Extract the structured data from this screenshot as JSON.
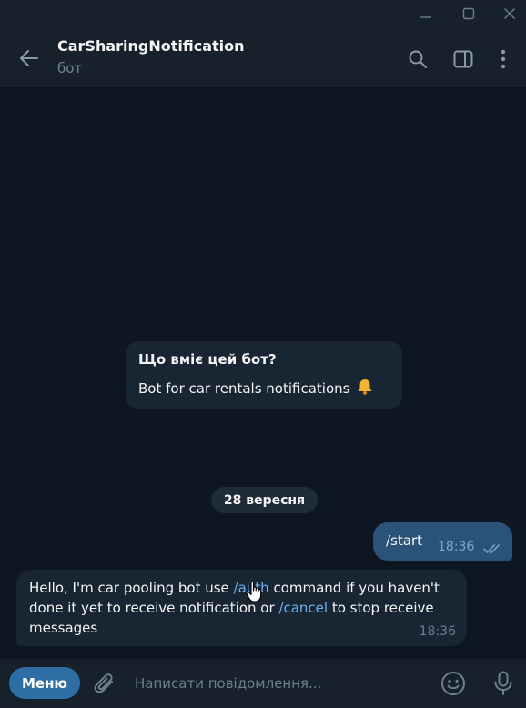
{
  "chat": {
    "title": "CarSharingNotification",
    "subtitle": "бот"
  },
  "intro": {
    "heading": "Що вміє цей бот?",
    "description": "Bot for car rentals notifications"
  },
  "date_separator": "28 вересня",
  "messages": {
    "outgoing": {
      "text": "/start",
      "time": "18:36"
    },
    "incoming": {
      "part1": "Hello, I'm car pooling bot use ",
      "link1": "/auth",
      "part2": " command if you haven't done it yet to receive notification or ",
      "link2": "/cancel",
      "part3": " to stop receive messages",
      "time": "18:36"
    }
  },
  "composer": {
    "menu_label": "Меню",
    "placeholder": "Написати повідомлення..."
  },
  "icons": {
    "window": [
      "minimize-icon",
      "maximize-icon",
      "close-icon"
    ],
    "header": [
      "back-arrow-icon",
      "search-icon",
      "sidebar-toggle-icon",
      "more-vertical-icon"
    ],
    "composer": [
      "attach-icon",
      "emoji-icon",
      "microphone-icon"
    ],
    "message": [
      "bell-icon",
      "double-check-icon",
      "hand-cursor-icon"
    ]
  },
  "colors": {
    "background": "#0e1621",
    "panel": "#17212b",
    "incoming_bubble": "#182533",
    "outgoing_bubble": "#2b5278",
    "link": "#6ab3f3",
    "menu_button": "#2f6ea5",
    "muted_text": "#708499"
  }
}
